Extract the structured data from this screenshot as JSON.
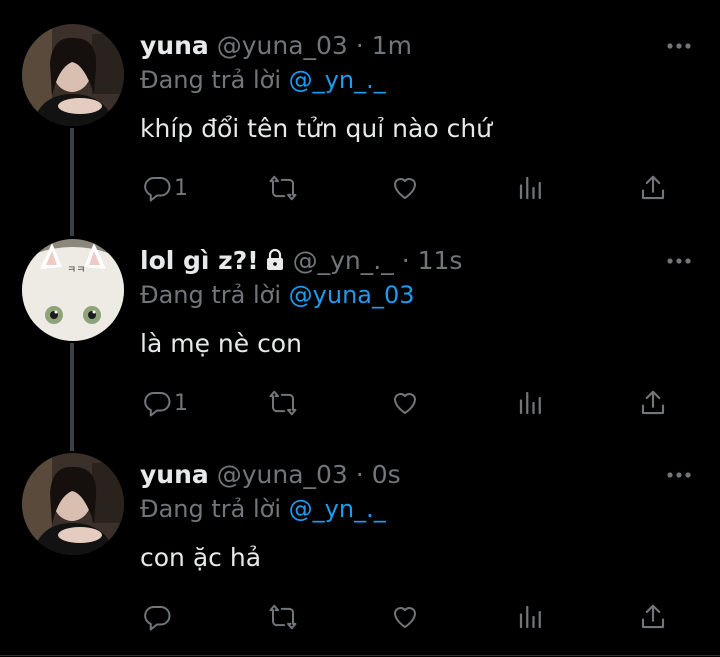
{
  "tweets": [
    {
      "name": "yuna",
      "handle": "@yuna_03",
      "separator": "·",
      "time": "1m",
      "reply_prefix": "Đang trả lời",
      "reply_to": "@_yn_._",
      "text": "khíp đổi tên tửn quỉ nào chứ",
      "reply_count": "1",
      "avatar": "woman-portrait"
    },
    {
      "name": "lol gì z?!",
      "handle": "@_yn_._",
      "separator": "·",
      "time": "11s",
      "reply_prefix": "Đang trả lời",
      "reply_to": "@yuna_03",
      "text": "là mẹ nè con",
      "reply_count": "1",
      "avatar": "white-cat",
      "avatar_overlay_text": "ㅋㅋ",
      "protected": true
    },
    {
      "name": "yuna",
      "handle": "@yuna_03",
      "separator": "·",
      "time": "0s",
      "reply_prefix": "Đang trả lời",
      "reply_to": "@_yn_._",
      "text": "con ặc hả",
      "reply_count": "",
      "avatar": "woman-portrait"
    }
  ],
  "icons": [
    "reply-icon",
    "retweet-icon",
    "like-icon",
    "analytics-icon",
    "share-icon",
    "more-icon",
    "lock-icon"
  ],
  "colors": {
    "background": "#000000",
    "text": "#e7e9ea",
    "muted": "#71767b",
    "link": "#1d9bf0"
  }
}
